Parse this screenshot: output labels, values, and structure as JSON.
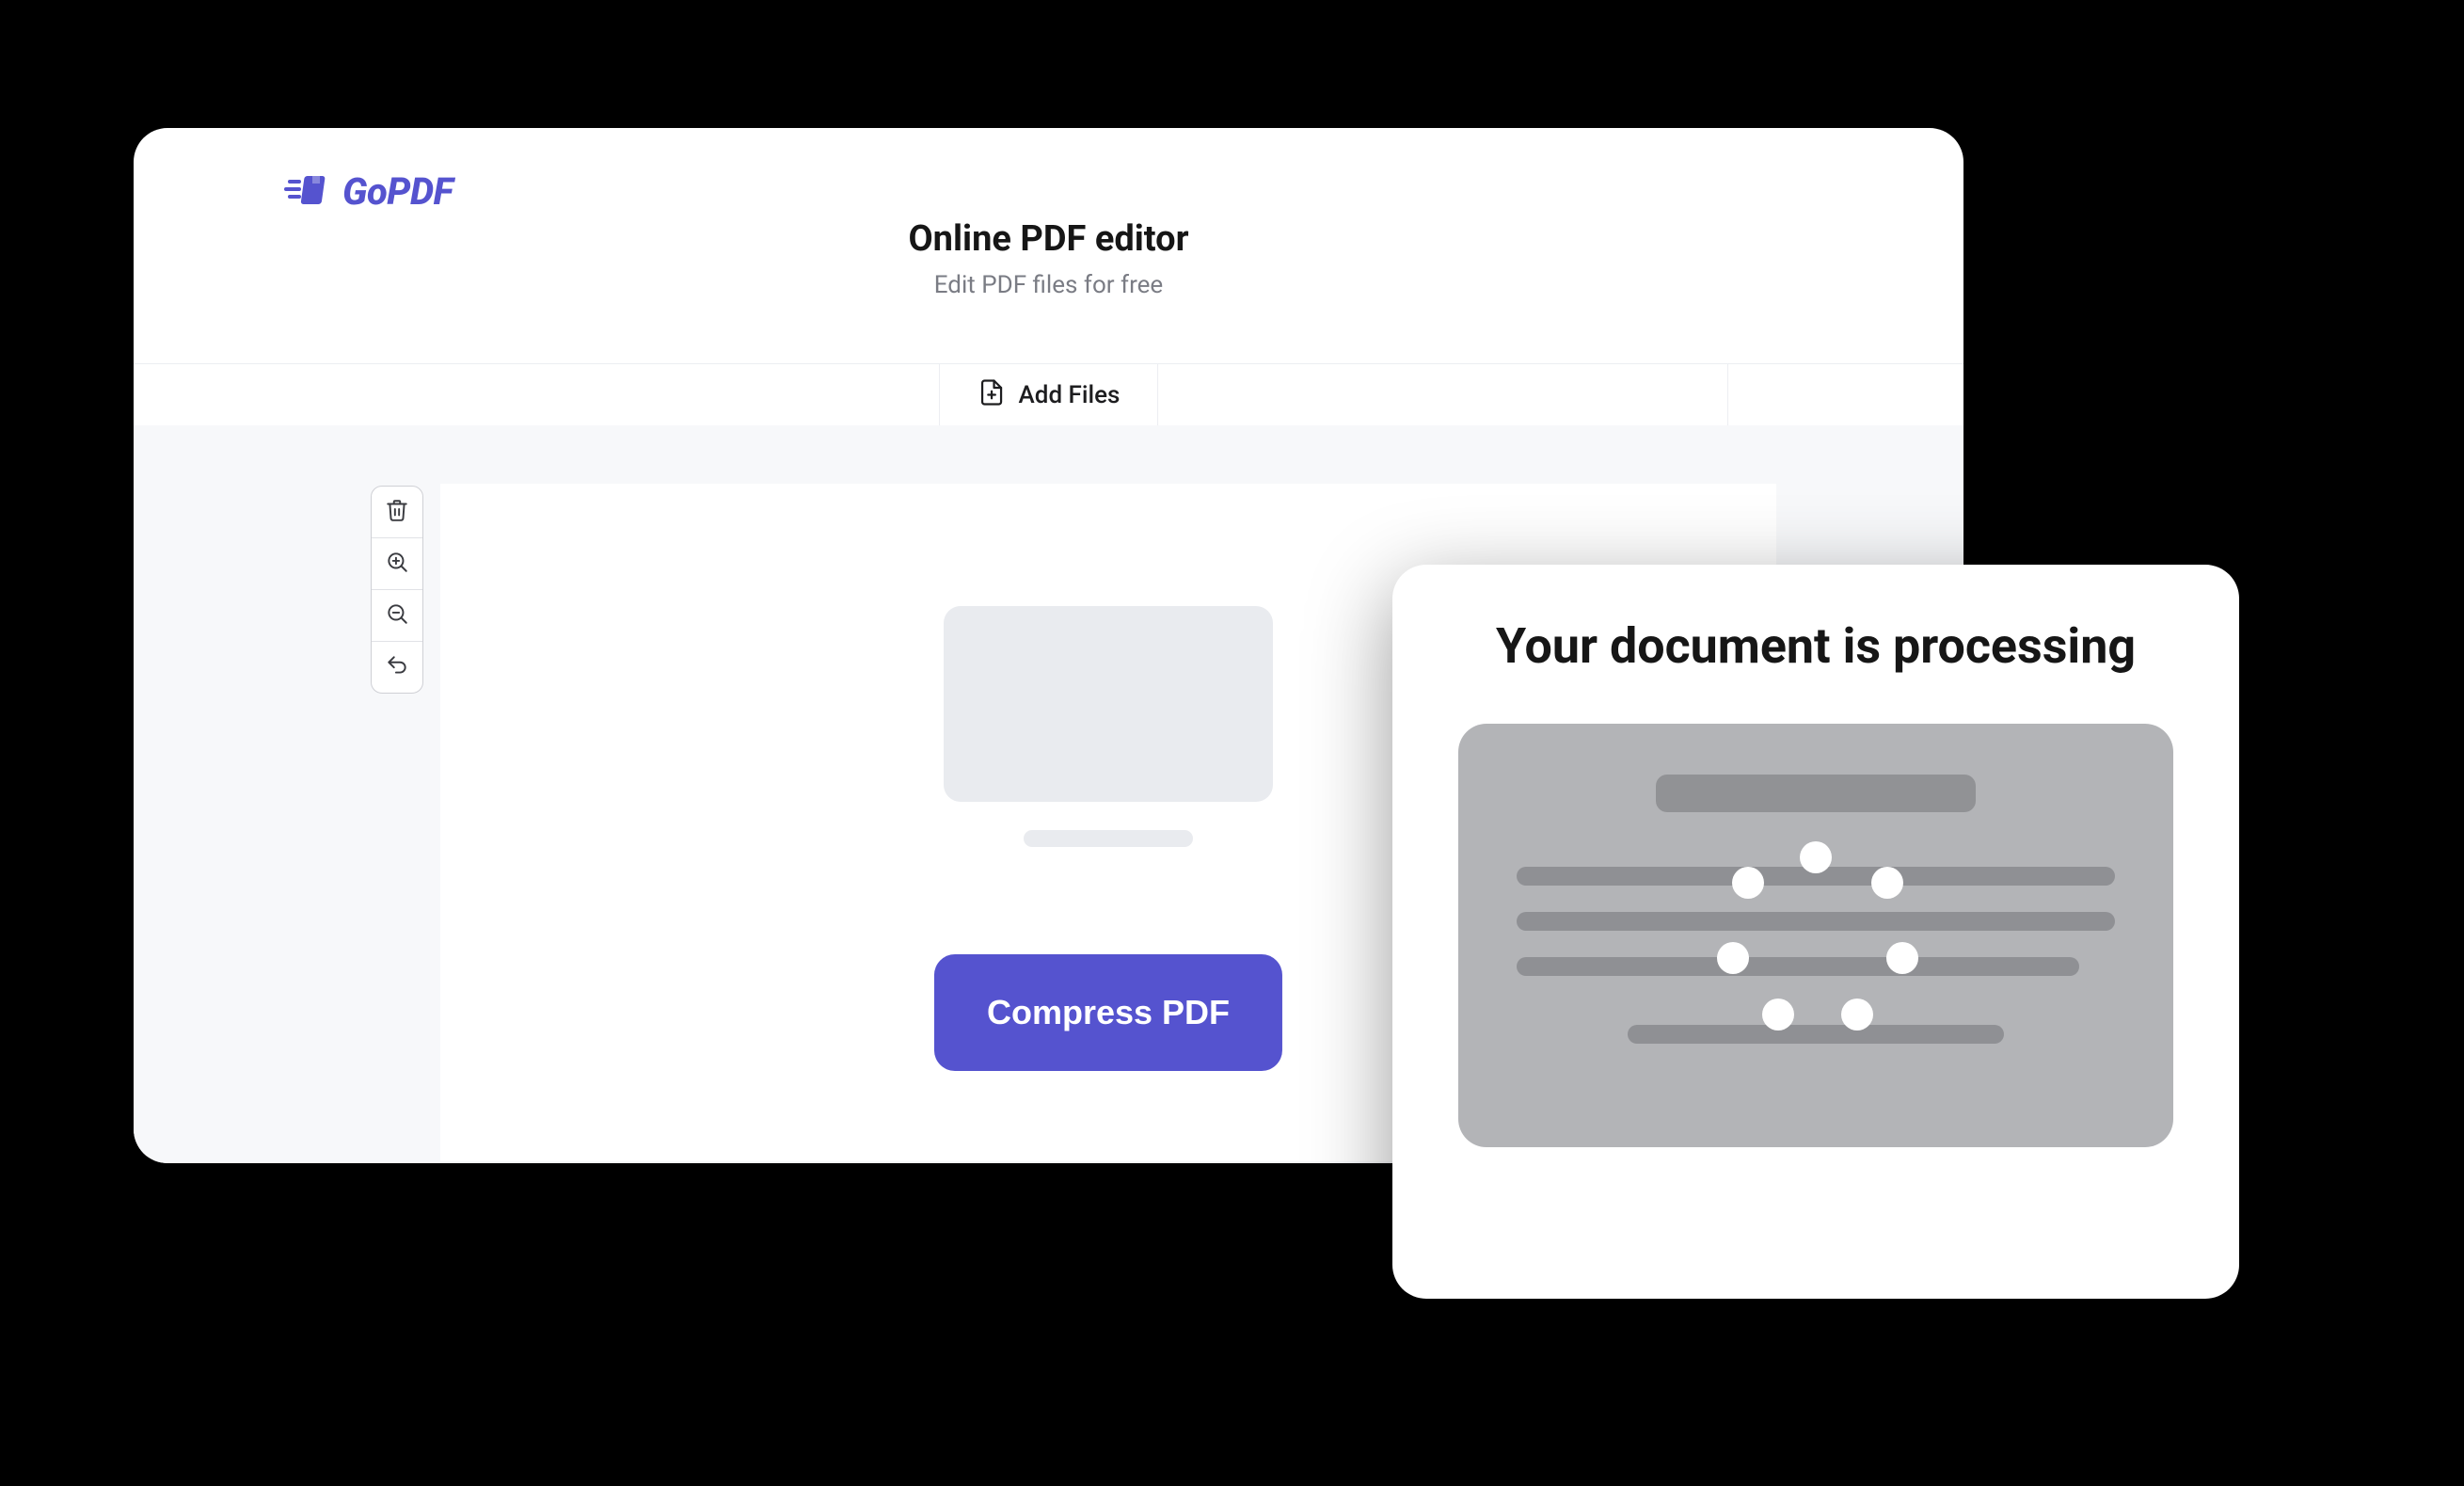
{
  "brand": {
    "name": "GoPDF",
    "accent": "#5553CF"
  },
  "header": {
    "title": "Online PDF editor",
    "subtitle": "Edit PDF files for free"
  },
  "toolbar": {
    "add_files_label": "Add Files"
  },
  "actions": {
    "compress_label": "Compress PDF"
  },
  "processing": {
    "title": "Your document is processing"
  }
}
